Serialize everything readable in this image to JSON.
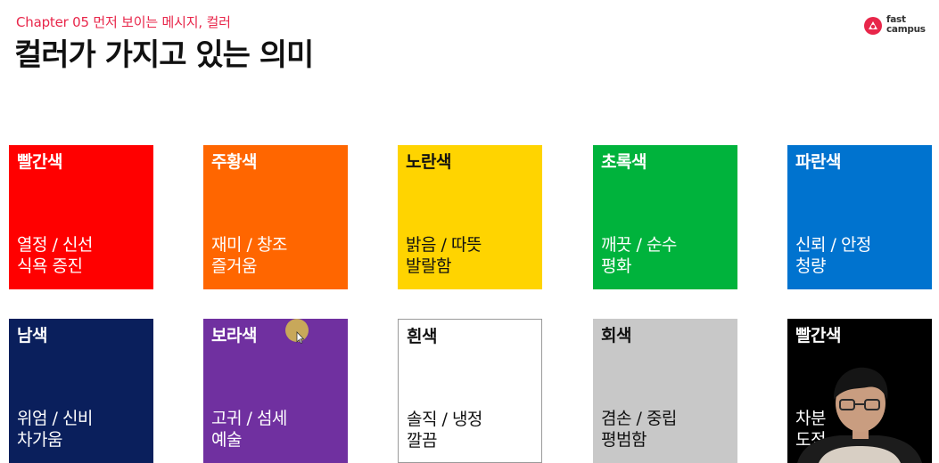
{
  "header": {
    "chapter": "Chapter 05 먼저 보이는 메시지, 컬러",
    "title": "컬러가 가지고 있는 의미"
  },
  "logo": {
    "line1": "fast",
    "line2": "campus",
    "color": "#e8264a"
  },
  "cards": [
    {
      "name": "빨간색",
      "line1": "열정 / 신선",
      "line2": "식욕 증진",
      "color": "#ff0000",
      "text_color": "light"
    },
    {
      "name": "주황색",
      "line1": "재미 / 창조",
      "line2": "즐거움",
      "color": "#ff6600",
      "text_color": "light"
    },
    {
      "name": "노란색",
      "line1": "밝음 / 따뜻",
      "line2": "발랄함",
      "color": "#ffd400",
      "text_color": "dark"
    },
    {
      "name": "초록색",
      "line1": "깨끗 / 순수",
      "line2": "평화",
      "color": "#00b33c",
      "text_color": "light"
    },
    {
      "name": "파란색",
      "line1": "신뢰 / 안정",
      "line2": "청량",
      "color": "#0073cf",
      "text_color": "light"
    },
    {
      "name": "남색",
      "line1": "위엄 / 신비",
      "line2": "차가움",
      "color": "#0a1f5c",
      "text_color": "light"
    },
    {
      "name": "보라색",
      "line1": "고귀 / 섬세",
      "line2": "예술",
      "color": "#7030a0",
      "text_color": "light"
    },
    {
      "name": "흰색",
      "line1": "솔직 / 냉정",
      "line2": "깔끔",
      "color": "#ffffff",
      "text_color": "dark"
    },
    {
      "name": "회색",
      "line1": "겸손 / 중립",
      "line2": "평범함",
      "color": "#c8c8c8",
      "text_color": "dark"
    },
    {
      "name": "빨간색",
      "line1": "차분",
      "line2": "도전",
      "color": "#000000",
      "text_color": "light"
    }
  ]
}
